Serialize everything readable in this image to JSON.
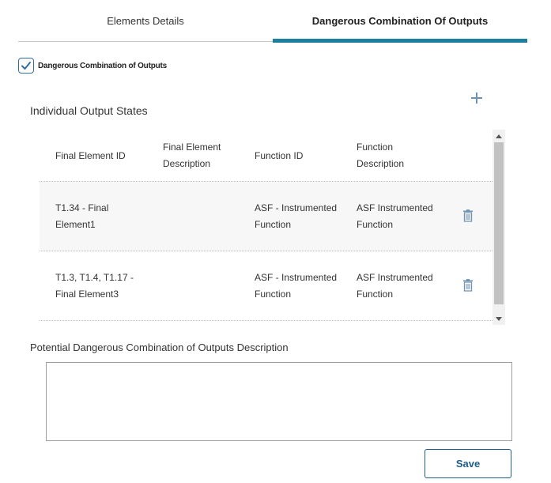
{
  "tabs": [
    {
      "label": "Elements Details",
      "active": false
    },
    {
      "label": "Dangerous Combination Of Outputs",
      "active": true
    }
  ],
  "checkbox": {
    "label": "Dangerous Combination of Outputs",
    "checked": true
  },
  "section": {
    "title": "Individual Output States",
    "add_icon": "plus-icon"
  },
  "table": {
    "headers": [
      "Final Element ID",
      "Final Element Description",
      "Function ID",
      "Function Description"
    ],
    "rows": [
      {
        "final_element_id": "T1.34 - Final Element1",
        "final_element_description": "",
        "function_id": "ASF - Instrumented Function",
        "function_description": "ASF Instrumented Function",
        "action_icon": "trash-icon"
      },
      {
        "final_element_id": "T1.3, T1.4, T1.17 - Final Element3",
        "final_element_description": "",
        "function_id": "ASF - Instrumented Function",
        "function_description": "ASF Instrumented Function",
        "action_icon": "trash-icon"
      }
    ]
  },
  "description": {
    "label": "Potential Dangerous Combination of Outputs Description",
    "value": "",
    "placeholder": ""
  },
  "save_label": "Save",
  "colors": {
    "accent": "#1d7fa0",
    "primary": "#1d5e8c",
    "icon": "#6f93b3"
  }
}
